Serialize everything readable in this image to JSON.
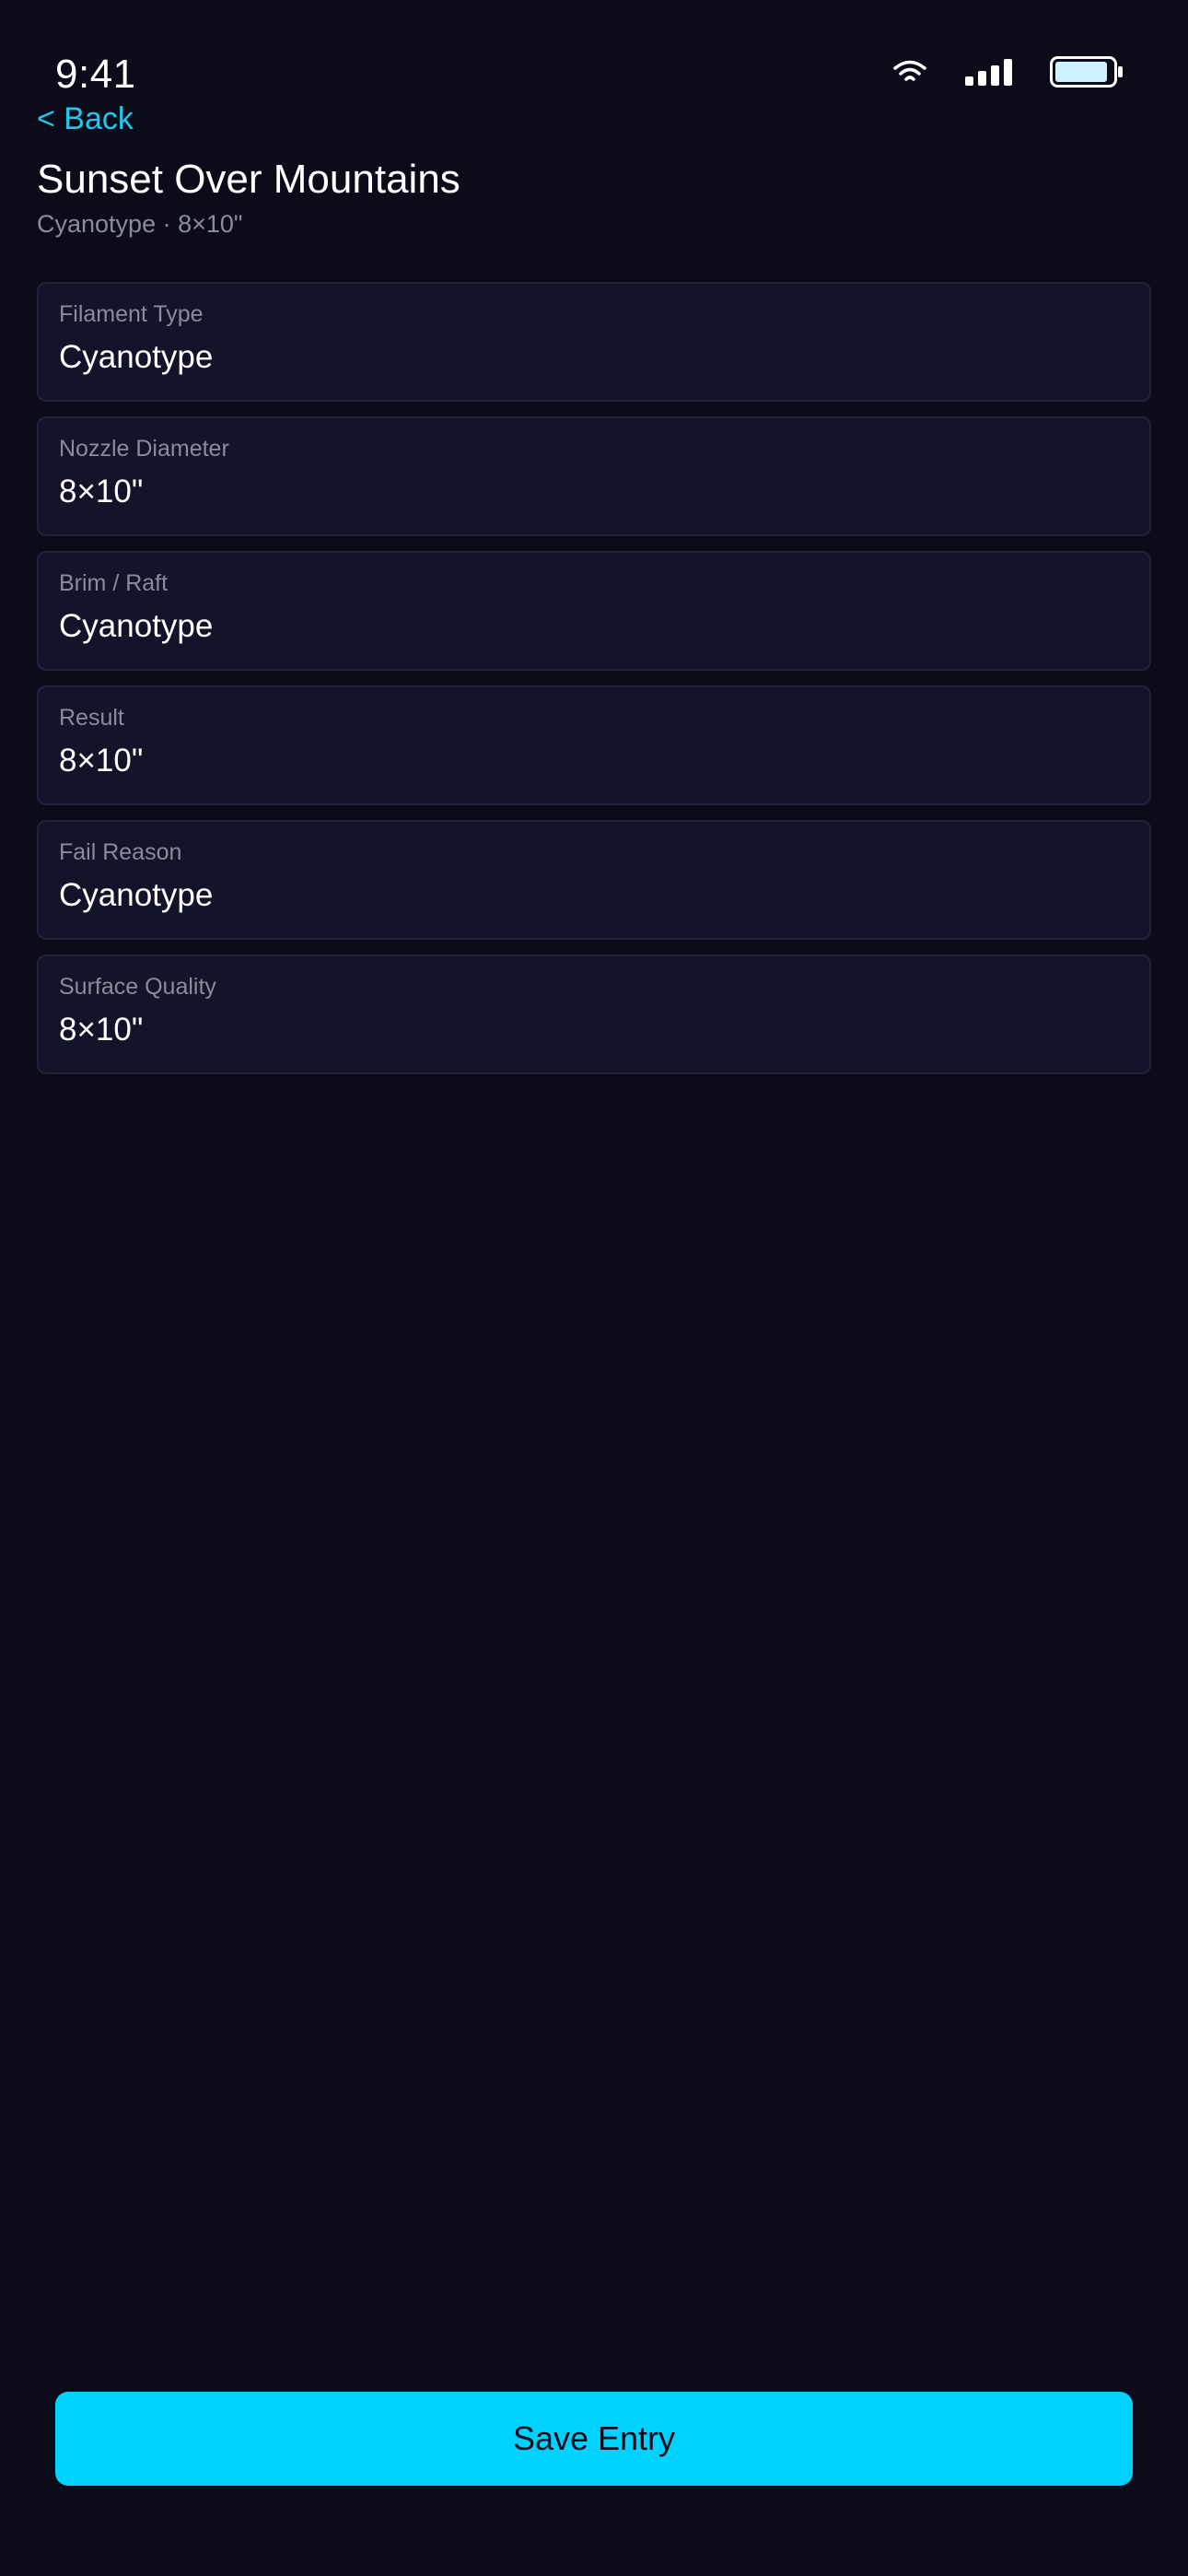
{
  "status_bar": {
    "time": "9:41",
    "icons": [
      "wifi-icon",
      "cellular-signal-icon",
      "battery-icon"
    ]
  },
  "header": {
    "back_label": "< Back",
    "title": "Sunset Over Mountains",
    "subtitle": "Cyanotype · 8×10\""
  },
  "fields": [
    {
      "label": "Filament Type",
      "value": "Cyanotype"
    },
    {
      "label": "Nozzle Diameter",
      "value": "8×10\""
    },
    {
      "label": "Brim / Raft",
      "value": "Cyanotype"
    },
    {
      "label": "Result",
      "value": "8×10\""
    },
    {
      "label": "Fail Reason",
      "value": "Cyanotype"
    },
    {
      "label": "Surface Quality",
      "value": "8×10\""
    }
  ],
  "actions": {
    "save_label": "Save Entry"
  },
  "colors": {
    "background": "#0b0b1a",
    "card": "#13132a",
    "accent": "#00d2ff",
    "link": "#1ec8f0",
    "muted_text": "#8b8b9e"
  }
}
